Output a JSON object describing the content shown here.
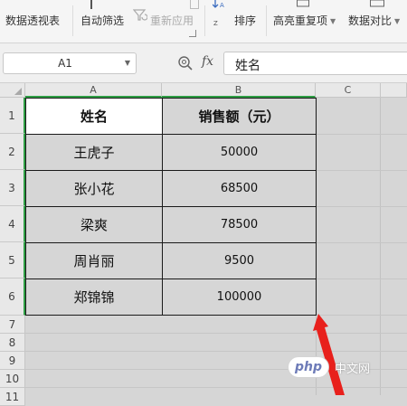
{
  "ribbon": {
    "pivot_label": "数据透视表",
    "autofilter_label": "自动筛选",
    "reapply_label": "重新应用",
    "sort_label": "排序",
    "highlight_dup_label": "高亮重复项",
    "compare_label": "数据对比"
  },
  "formula_bar": {
    "name_box": "A1",
    "fx_label": "fx",
    "formula": "姓名"
  },
  "columns": [
    "A",
    "B",
    "C"
  ],
  "rows": [
    "1",
    "2",
    "3",
    "4",
    "5",
    "6",
    "7",
    "8",
    "9",
    "10",
    "11"
  ],
  "table": {
    "headers": [
      "姓名",
      "销售额（元）"
    ],
    "data": [
      [
        "王虎子",
        "50000"
      ],
      [
        "张小花",
        "68500"
      ],
      [
        "梁爽",
        "78500"
      ],
      [
        "周肖丽",
        "9500"
      ],
      [
        "郑锦锦",
        "100000"
      ]
    ]
  },
  "watermark": {
    "logo": "php",
    "text": "中文网"
  },
  "colors": {
    "selection_border": "#2e9e44",
    "arrow": "#e8201c",
    "sheet_bg": "#d6d6d6"
  }
}
